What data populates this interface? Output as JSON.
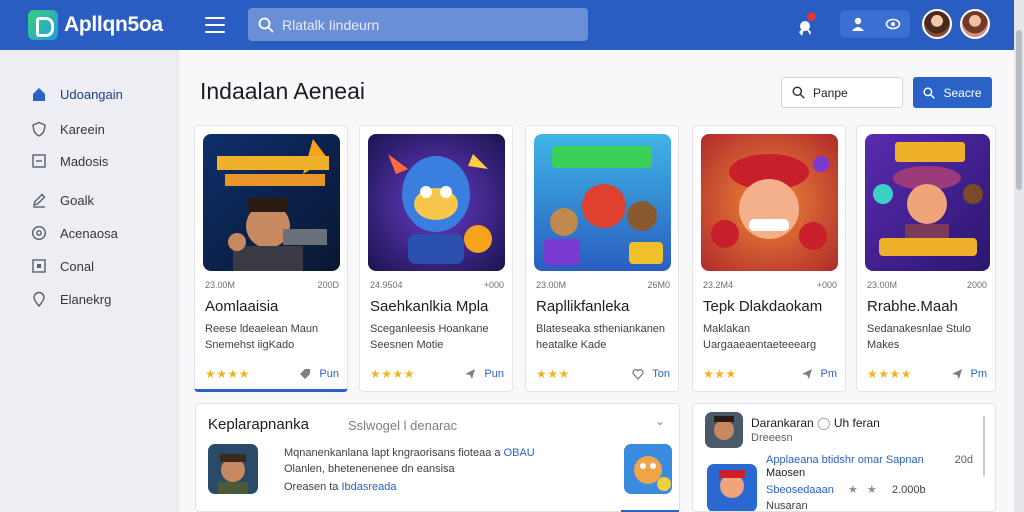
{
  "brand": {
    "name": "Apllqn5oa"
  },
  "topbar": {
    "search_placeholder": "Rlatalk Iindeurn"
  },
  "sidebar": {
    "items": [
      {
        "label": "Udoangain",
        "icon": "home-icon",
        "active": true
      },
      {
        "label": "Kareein",
        "icon": "shield-icon",
        "active": false
      },
      {
        "label": "Madosis",
        "icon": "list-icon",
        "active": false
      },
      {
        "label": "Goalk",
        "icon": "edit-icon",
        "active": false
      },
      {
        "label": "Acenaosa",
        "icon": "gauge-icon",
        "active": false
      },
      {
        "label": "Conal",
        "icon": "box-icon",
        "active": false
      },
      {
        "label": "Elanekrg",
        "icon": "pin-icon",
        "active": false
      }
    ]
  },
  "main": {
    "title": "Indaalan Aeneai",
    "filter_placeholder": "Panpe",
    "search_label": "Seacre"
  },
  "cards": [
    {
      "meta_left": "23.00M",
      "meta_right": "200D",
      "title": "Aomlaaisia",
      "desc": "Reese ldeaelean Maun Snemehst iigKado",
      "stars": "★★★★",
      "get": "Pun"
    },
    {
      "meta_left": "24.9504",
      "meta_right": "+000",
      "title": "Saehkanlkia Mpla",
      "desc": "Sceganleesis Hoankane Seesnen Motie",
      "stars": "★★★★",
      "get": "Pun"
    },
    {
      "meta_left": "23.00M",
      "meta_right": "26M0",
      "title": "Rapllikfanleka",
      "desc": "Blateseaka stheniankanen heatalke Kade",
      "stars": "★★★",
      "get": "Ton"
    },
    {
      "meta_left": "23.2M4",
      "meta_right": "+000",
      "title": "Tepk Dlakdaokam",
      "desc": "Maklakan Uargaaeaentaeteeearg",
      "stars": "★★★",
      "get": "Pm"
    },
    {
      "meta_left": "23.00M",
      "meta_right": "2000",
      "title": "Rrabhe.Maah",
      "desc": "Sedanakesnlae Stulo Makes",
      "stars": "★★★★",
      "get": "Pm"
    }
  ],
  "panel_left": {
    "title": "Keplarapnanka",
    "subtitle": "Sslwogel l denarac",
    "line1": "Mqnanenkanlana lapt kngraorisans fioteaa a",
    "line1_accent": "OBAU",
    "line2": "Olanlen, bhetenenenee dn eansisa",
    "line3_pre": "Oreasen ta",
    "line3_accent": "Ibdasreada"
  },
  "panel_right": {
    "name": "Darankaran",
    "extra": "Uh feran",
    "sub": "Dreeesn",
    "link": "Applaeana btidshr omar Sapnan",
    "date": "20d",
    "line2": "Maosen",
    "link2": "Sbeosedaaan",
    "count": "2.000b",
    "line4": "Nusaran"
  }
}
